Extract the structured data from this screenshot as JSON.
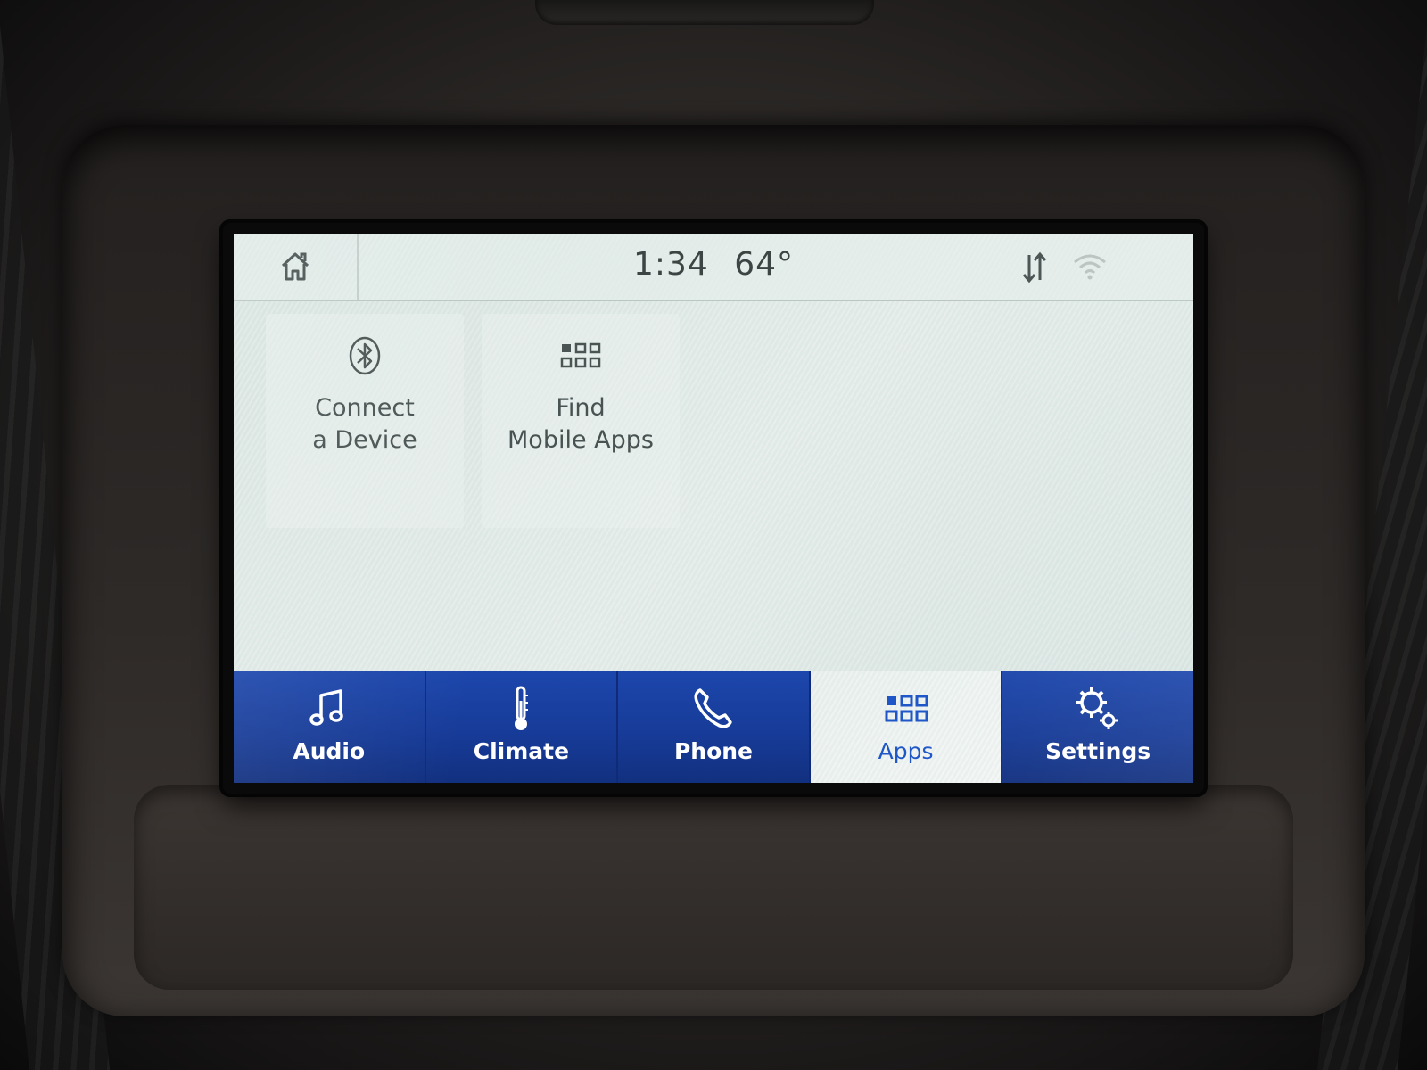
{
  "status_bar": {
    "time": "1:34",
    "temperature": "64°",
    "home_icon": "home-icon",
    "sync_icon": "sync-arrows-icon",
    "wifi_icon": "wifi-icon"
  },
  "tiles": [
    {
      "line1": "Connect",
      "line2": "a Device",
      "icon": "bluetooth-icon"
    },
    {
      "line1": "Find",
      "line2": "Mobile Apps",
      "icon": "apps-grid-icon"
    }
  ],
  "nav": {
    "active": "Apps",
    "items": [
      {
        "label": "Audio",
        "icon": "music-note-icon"
      },
      {
        "label": "Climate",
        "icon": "thermometer-icon"
      },
      {
        "label": "Phone",
        "icon": "phone-icon"
      },
      {
        "label": "Apps",
        "icon": "apps-grid-icon"
      },
      {
        "label": "Settings",
        "icon": "gears-icon"
      }
    ]
  },
  "colors": {
    "nav_blue": "#173c9b",
    "active_label": "#1e56c8",
    "screen_bg": "#dfe8e5",
    "text_dark": "#3c4543"
  }
}
